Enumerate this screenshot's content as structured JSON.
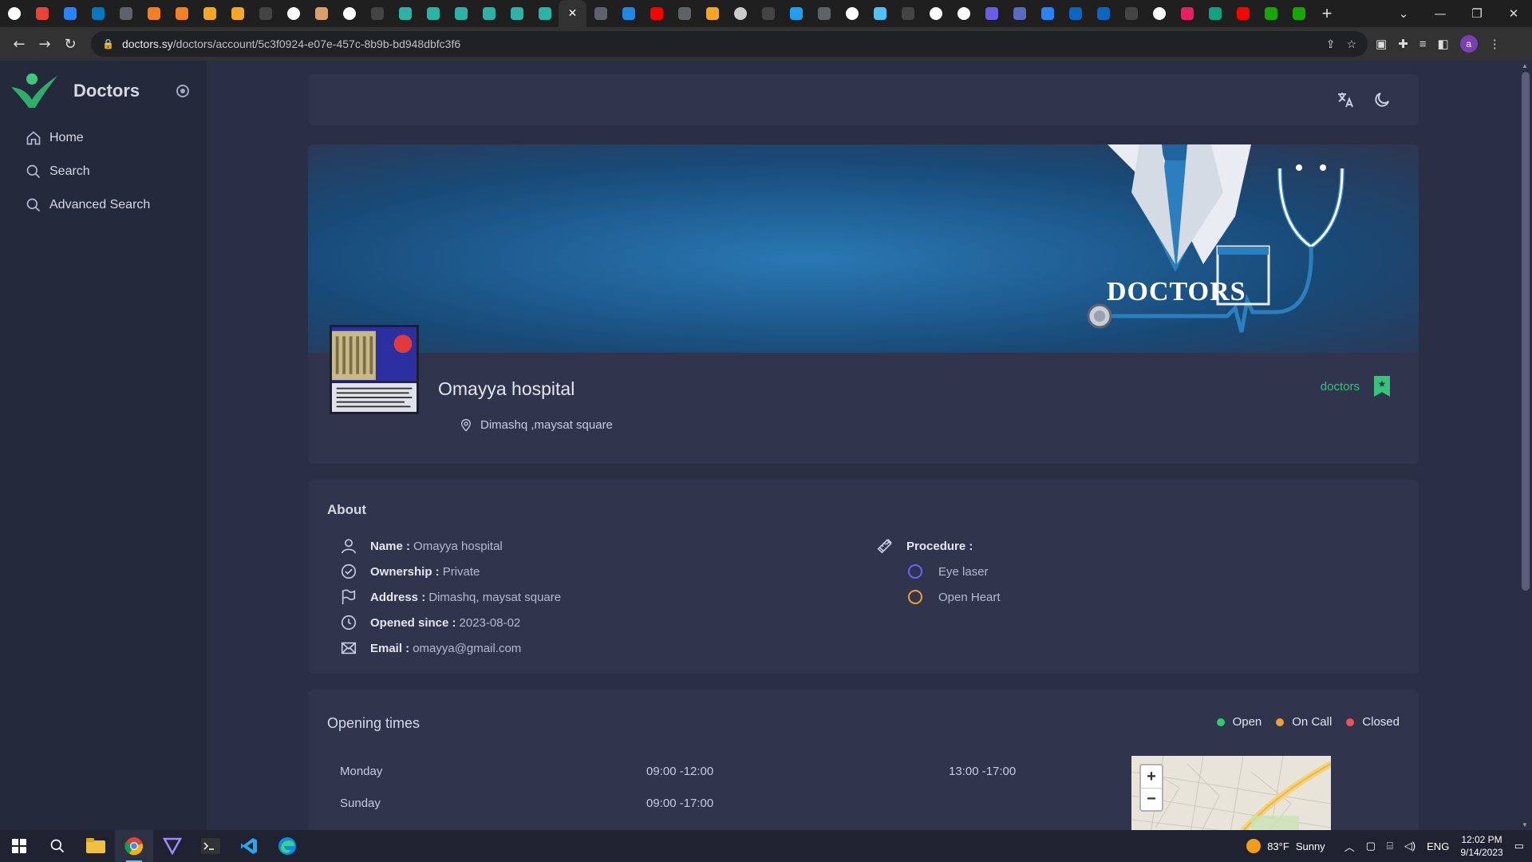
{
  "browser": {
    "url_host": "doctors.sy",
    "url_path": "/doctors/account/5c3f0924-e07e-457c-8b9b-bd948dbfc3f6",
    "profile_initial": "a",
    "tab_close_glyph": "✕",
    "new_tab_glyph": "+",
    "window_controls": [
      "⌄",
      "—",
      "❐",
      "✕"
    ],
    "tabs": [
      {
        "icon": "google-icon",
        "color": "#ffffff"
      },
      {
        "icon": "gmail-icon",
        "color": "#ea4335"
      },
      {
        "icon": "jira-icon",
        "color": "#2684ff"
      },
      {
        "icon": "trello-icon",
        "color": "#0079bf"
      },
      {
        "icon": "globe-icon",
        "color": "#5f6368"
      },
      {
        "icon": "stackoverflow-icon",
        "color": "#f48024"
      },
      {
        "icon": "stackoverflow-icon",
        "color": "#f48024"
      },
      {
        "icon": "infinity-icon",
        "color": "#f5a623"
      },
      {
        "icon": "chart-icon",
        "color": "#f5a623"
      },
      {
        "icon": "github-icon",
        "color": "#444444"
      },
      {
        "icon": "letter-a-icon",
        "color": "#ffffff"
      },
      {
        "icon": "avatar-icon",
        "color": "#d9a06b"
      },
      {
        "icon": "dev-icon",
        "color": "#ffffff"
      },
      {
        "icon": "github-icon",
        "color": "#444444"
      },
      {
        "icon": "wave-icon",
        "color": "#2bb3a6"
      },
      {
        "icon": "wave-icon",
        "color": "#2bb3a6"
      },
      {
        "icon": "wave-icon",
        "color": "#2bb3a6"
      },
      {
        "icon": "wave-icon",
        "color": "#2bb3a6"
      },
      {
        "icon": "wave-icon",
        "color": "#2bb3a6"
      },
      {
        "icon": "wave-icon",
        "color": "#2bb3a6"
      },
      {
        "icon": "close-icon",
        "color": "#ffffff",
        "active": true
      },
      {
        "icon": "globe-icon",
        "color": "#5f6368"
      },
      {
        "icon": "chat-icon",
        "color": "#1e88e5"
      },
      {
        "icon": "youtube-icon",
        "color": "#ff0000"
      },
      {
        "icon": "globe-icon",
        "color": "#5f6368"
      },
      {
        "icon": "infinity-icon",
        "color": "#f5a623"
      },
      {
        "icon": "book-icon",
        "color": "#cccccc"
      },
      {
        "icon": "github-icon",
        "color": "#444444"
      },
      {
        "icon": "bird-icon",
        "color": "#1da1f2"
      },
      {
        "icon": "globe-icon",
        "color": "#5f6368"
      },
      {
        "icon": "google-icon",
        "color": "#ffffff"
      },
      {
        "icon": "cube-icon",
        "color": "#4fc3f7"
      },
      {
        "icon": "github-icon",
        "color": "#444444"
      },
      {
        "icon": "google-icon",
        "color": "#ffffff"
      },
      {
        "icon": "jd-icon",
        "color": "#ffffff"
      },
      {
        "icon": "letter-a-icon",
        "color": "#6c5ce7"
      },
      {
        "icon": "gear-icon",
        "color": "#5c6bc0"
      },
      {
        "icon": "jira-icon",
        "color": "#2684ff"
      },
      {
        "icon": "linkedin-icon",
        "color": "#0a66c2"
      },
      {
        "icon": "linkedin-icon",
        "color": "#0a66c2"
      },
      {
        "icon": "github-icon",
        "color": "#444444"
      },
      {
        "icon": "google-icon",
        "color": "#ffffff"
      },
      {
        "icon": "record-icon",
        "color": "#e91e63"
      },
      {
        "icon": "chatgpt-icon",
        "color": "#10a37f"
      },
      {
        "icon": "youtube-icon",
        "color": "#ff0000"
      },
      {
        "icon": "upwork-icon",
        "color": "#14a800"
      },
      {
        "icon": "upwork-icon",
        "color": "#14a800"
      }
    ]
  },
  "sidebar": {
    "brand": "Doctors",
    "items": [
      {
        "label": "Home",
        "icon": "home-icon"
      },
      {
        "label": "Search",
        "icon": "search-icon"
      },
      {
        "label": "Advanced Search",
        "icon": "search-icon"
      }
    ]
  },
  "header": {
    "icons": [
      "translate-icon",
      "moon-icon"
    ]
  },
  "profile": {
    "banner_word": "DOCTORS",
    "name": "Omayya hospital",
    "address": "Dimashq ,maysat square",
    "tag": "doctors"
  },
  "about": {
    "title": "About",
    "rows": [
      {
        "key": "Name :",
        "value": "Omayya hospital",
        "icon": "user-icon"
      },
      {
        "key": "Ownership :",
        "value": "Private",
        "icon": "check-circle-icon"
      },
      {
        "key": "Address :",
        "value": "Dimashq, maysat square",
        "icon": "flag-icon"
      },
      {
        "key": "Opened since :",
        "value": "2023-08-02",
        "icon": "clock-icon"
      },
      {
        "key": "Email :",
        "value": "omayya@gmail.com",
        "icon": "mail-icon"
      }
    ],
    "procedure_label": "Procedure :",
    "procedures": [
      {
        "name": "Eye laser",
        "color": "#6c63ff"
      },
      {
        "name": "Open Heart",
        "color": "#f0a030"
      }
    ]
  },
  "times": {
    "title": "Opening times",
    "legend": [
      {
        "label": "Open",
        "color": "#2ecc71"
      },
      {
        "label": "On Call",
        "color": "#f0a030"
      },
      {
        "label": "Closed",
        "color": "#ea5455"
      }
    ],
    "rows": [
      {
        "day": "Monday",
        "slot1": "09:00 -12:00",
        "slot2": "13:00 -17:00"
      },
      {
        "day": "Sunday",
        "slot1": "09:00 -17:00",
        "slot2": ""
      }
    ],
    "map_zoom_in": "+",
    "map_zoom_out": "−"
  },
  "taskbar": {
    "temperature": "83°F",
    "weather": "Sunny",
    "language": "ENG",
    "time": "12:02 PM",
    "date": "9/14/2023",
    "apps": [
      "windows-icon",
      "search-icon",
      "file-explorer-icon",
      "chrome-icon",
      "vpn-icon",
      "terminal-icon",
      "vscode-icon",
      "edge-icon"
    ]
  }
}
